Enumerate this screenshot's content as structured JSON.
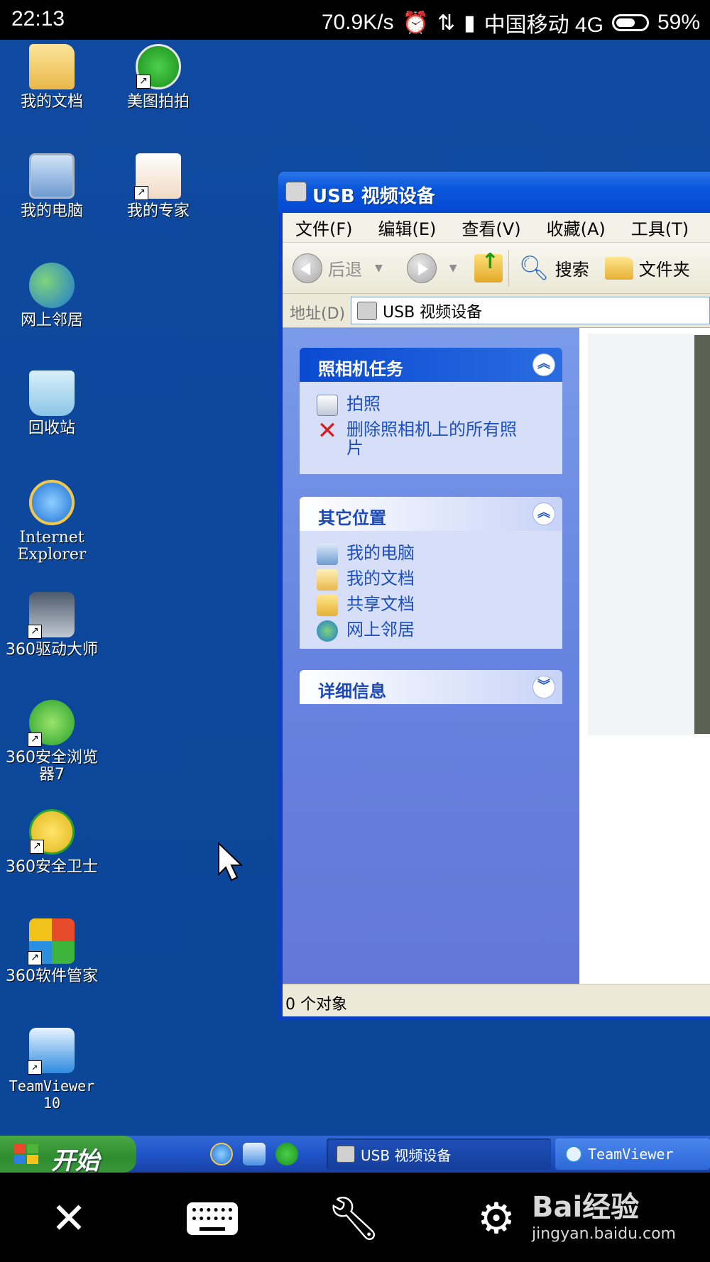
{
  "statusbar": {
    "time": "22:13",
    "speed": "70.9K/s",
    "carrier": "中国移动 4G",
    "battery": "59%"
  },
  "desktop_icons": [
    {
      "label": "我的文档"
    },
    {
      "label": "美图拍拍"
    },
    {
      "label": "我的电脑"
    },
    {
      "label": "我的专家"
    },
    {
      "label": "网上邻居"
    },
    {
      "label": "回收站"
    },
    {
      "label": "Internet Explorer"
    },
    {
      "label": "360驱动大师"
    },
    {
      "label": "360安全浏览器7"
    },
    {
      "label": "360安全卫士"
    },
    {
      "label": "360软件管家"
    },
    {
      "label": "TeamViewer 10"
    }
  ],
  "window": {
    "title": "USB 视频设备",
    "menu": [
      "文件(F)",
      "编辑(E)",
      "查看(V)",
      "收藏(A)",
      "工具(T)"
    ],
    "toolbar": {
      "back": "后退",
      "search": "搜索",
      "folders": "文件夹"
    },
    "address_label": "地址(D)",
    "address_value": "USB 视频设备",
    "camera_tasks": {
      "title": "照相机任务",
      "items": [
        "拍照",
        "删除照相机上的所有照片"
      ]
    },
    "other_places": {
      "title": "其它位置",
      "items": [
        "我的电脑",
        "我的文档",
        "共享文档",
        "网上邻居"
      ]
    },
    "details": {
      "title": "详细信息"
    },
    "status": "0 个对象"
  },
  "taskbar": {
    "start": "开始",
    "tasks": [
      "USB 视频设备",
      "TeamViewer"
    ]
  },
  "watermark": {
    "brand": "Bai经验",
    "url": "jingyan.baidu.com"
  }
}
